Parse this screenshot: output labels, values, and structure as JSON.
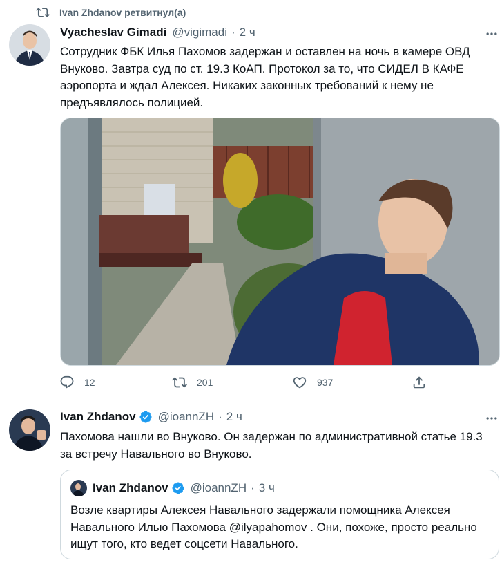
{
  "retweet": {
    "label": "Ivan Zhdanov ретвитнул(а)",
    "icon": "retweet-icon"
  },
  "tweet1": {
    "name": "Vyacheslav Gimadi",
    "handle": "@vigimadi",
    "separator": "·",
    "time": "2 ч",
    "text": "Сотрудник ФБК Илья Пахомов задержан и оставлен на ночь в камере ОВД Внуково. Завтра суд по ст. 19.3 КоАП. Протокол за то, что СИДЕЛ В КАФЕ аэропорта и ждал Алексея. Никаких законных требований к нему не предъявлялось полицией.",
    "actions": {
      "reply_count": "12",
      "retweet_count": "201",
      "like_count": "937"
    }
  },
  "tweet2": {
    "name": "Ivan Zhdanov",
    "handle": "@ioannZH",
    "separator": "·",
    "time": "2 ч",
    "text": "Пахомова нашли во Внуково. Он задержан по административной статье 19.3 за встречу Навального во Внуково.",
    "quote": {
      "name": "Ivan Zhdanov",
      "handle": "@ioannZH",
      "separator": "·",
      "time": "3 ч",
      "text": "Возле квартиры Алексея Навального задержали помощника Алексея Навального Илью Пахомова @ilyapahomov . Они, похоже, просто реально ищут того, кто ведет соцсети Навального."
    }
  },
  "colors": {
    "text": "#0f1419",
    "muted": "#536471",
    "verified": "#1d9bf0",
    "border": "#cfd9de"
  }
}
